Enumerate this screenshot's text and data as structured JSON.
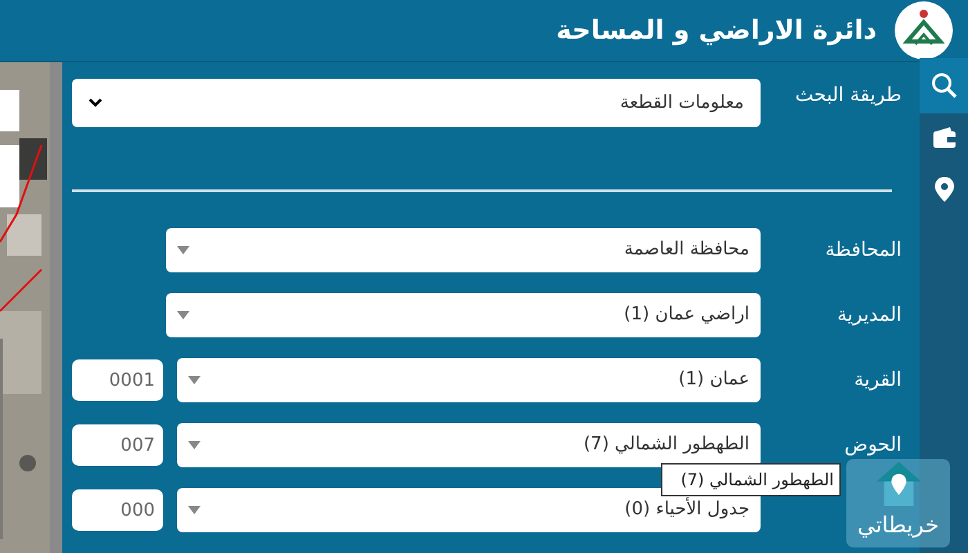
{
  "header": {
    "title": "دائرة الاراضي و المساحة"
  },
  "search_method": {
    "label": "طريقة البحث",
    "value": "معلومات القطعة"
  },
  "fields": [
    {
      "label": "المحافظة",
      "value": "محافظة العاصمة"
    },
    {
      "label": "المديرية",
      "value": "اراضي عمان (1)"
    },
    {
      "label": "القرية",
      "value": "عمان (1)",
      "code": "0001"
    },
    {
      "label": "الحوض",
      "value": "الطهطور الشمالي (7)",
      "code": "007"
    },
    {
      "value": "جدول الأحياء (0)",
      "code": "000"
    }
  ],
  "tooltip": "الطهطور الشمالي (7)",
  "maps_widget": {
    "label": "خريطاتي"
  }
}
